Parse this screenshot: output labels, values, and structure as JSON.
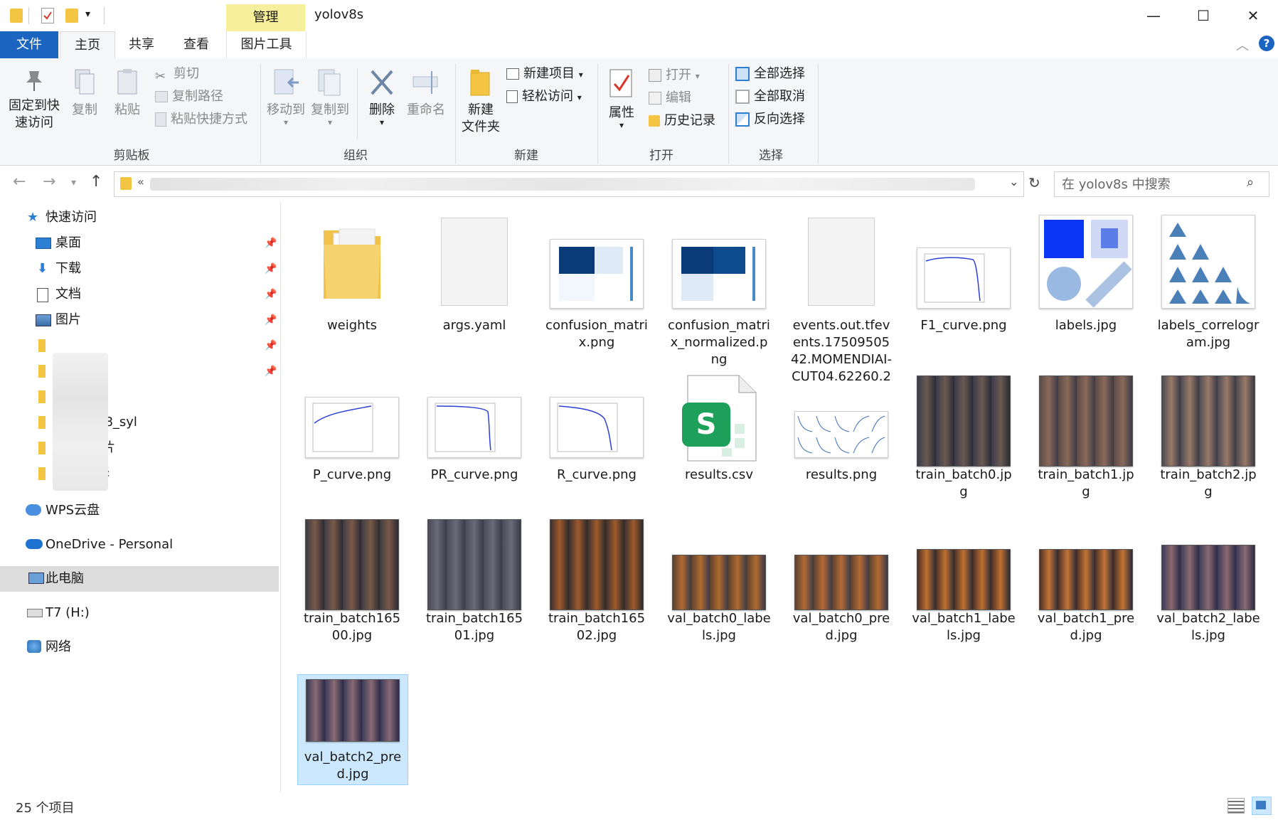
{
  "window": {
    "title": "yolov8s",
    "context_tab": "管理",
    "minimize": "—",
    "maximize": "☐",
    "close": "✕"
  },
  "ribbon_tabs": [
    "文件",
    "主页",
    "共享",
    "查看",
    "图片工具"
  ],
  "ribbon": {
    "clipboard": {
      "label": "剪贴板",
      "pin": "固定到快速访问",
      "pin_l1": "固定到快",
      "pin_l2": "速访问",
      "copy": "复制",
      "paste": "粘贴",
      "cut": "剪切",
      "copy_path": "复制路径",
      "paste_shortcut": "粘贴快捷方式"
    },
    "organize": {
      "label": "组织",
      "move_to": "移动到",
      "copy_to": "复制到",
      "delete": "删除",
      "rename": "重命名"
    },
    "new": {
      "label": "新建",
      "new_folder_l1": "新建",
      "new_folder_l2": "文件夹",
      "new_item": "新建项目",
      "easy_access": "轻松访问"
    },
    "open": {
      "label": "打开",
      "properties": "属性",
      "open": "打开",
      "edit": "编辑",
      "history": "历史记录"
    },
    "select": {
      "label": "选择",
      "select_all": "全部选择",
      "select_none": "全部取消",
      "invert": "反向选择"
    }
  },
  "address": {
    "prefix": "«",
    "search_placeholder": "在 yolov8s 中搜索"
  },
  "sidebar": {
    "quick_access": "快速访问",
    "items": [
      {
        "label": "桌面",
        "pinned": true
      },
      {
        "label": "下载",
        "pinned": true
      },
      {
        "label": "文档",
        "pinned": true
      },
      {
        "label": "图片",
        "pinned": true
      }
    ],
    "partial_1": "08_syl",
    "partial_2": "片",
    "partial_3": "译",
    "wps": "WPS云盘",
    "onedrive": "OneDrive - Personal",
    "this_pc": "此电脑",
    "drive": "T7 (H:)",
    "network": "网络"
  },
  "files": [
    {
      "name": "weights",
      "kind": "folder"
    },
    {
      "name": "args.yaml",
      "kind": "doc"
    },
    {
      "name": "confusion_matrix.png",
      "kind": "cm"
    },
    {
      "name": "confusion_matrix_normalized.png",
      "kind": "cm"
    },
    {
      "name": "events.out.tfevents.1750950542.MOMENDIAI-CUT04.62260.2",
      "kind": "doc"
    },
    {
      "name": "F1_curve.png",
      "kind": "curve"
    },
    {
      "name": "labels.jpg",
      "kind": "labels"
    },
    {
      "name": "labels_correlogram.jpg",
      "kind": "correlogram"
    },
    {
      "name": "P_curve.png",
      "kind": "curve"
    },
    {
      "name": "PR_curve.png",
      "kind": "curve"
    },
    {
      "name": "R_curve.png",
      "kind": "curve"
    },
    {
      "name": "results.csv",
      "kind": "csv"
    },
    {
      "name": "results.png",
      "kind": "results"
    },
    {
      "name": "train_batch0.jpg",
      "kind": "photo"
    },
    {
      "name": "train_batch1.jpg",
      "kind": "photo"
    },
    {
      "name": "train_batch2.jpg",
      "kind": "photo"
    },
    {
      "name": "train_batch16500.jpg",
      "kind": "photo"
    },
    {
      "name": "train_batch16501.jpg",
      "kind": "photo"
    },
    {
      "name": "train_batch16502.jpg",
      "kind": "photo"
    },
    {
      "name": "val_batch0_labels.jpg",
      "kind": "wide"
    },
    {
      "name": "val_batch0_pred.jpg",
      "kind": "wide"
    },
    {
      "name": "val_batch1_labels.jpg",
      "kind": "wide"
    },
    {
      "name": "val_batch1_pred.jpg",
      "kind": "wide"
    },
    {
      "name": "val_batch2_labels.jpg",
      "kind": "wide"
    },
    {
      "name": "val_batch2_pred.jpg",
      "kind": "wide-selected"
    }
  ],
  "status": {
    "count": "25 个项目"
  },
  "colors": {
    "file_tab": "#1b64c0",
    "manage_tab": "#f6ef9c",
    "selection": "#cce8ff",
    "folder": "#f4c542"
  }
}
